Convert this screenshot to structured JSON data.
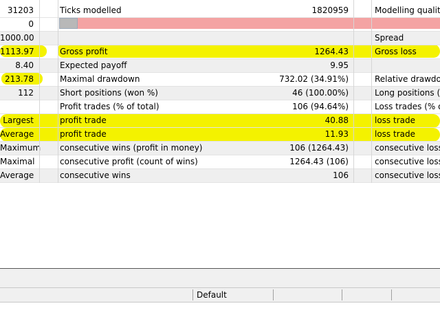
{
  "rows": [
    {
      "v1": "31203",
      "l2": "Ticks modelled",
      "v3": "1820959",
      "l4": "Modelling quality"
    },
    {
      "v1": "0",
      "l2": "",
      "v3": "",
      "l4": ""
    },
    {
      "v1": "1000.00",
      "l2": "",
      "v3": "",
      "l4": "Spread"
    },
    {
      "v1": "1113.97",
      "l2": "Gross profit",
      "v3": "1264.43",
      "l4": "Gross loss"
    },
    {
      "v1": "8.40",
      "l2": "Expected payoff",
      "v3": "9.95",
      "l4": ""
    },
    {
      "v1": "213.78",
      "l2": "Maximal drawdown",
      "v3": "732.02 (34.91%)",
      "l4": "Relative drawdown"
    },
    {
      "v1": "112",
      "l2": "Short positions (won %)",
      "v3": "46 (100.00%)",
      "l4": "Long positions (wo"
    },
    {
      "v1": "",
      "l2": "Profit trades (% of total)",
      "v3": "106 (94.64%)",
      "l4": "Loss trades (% of t"
    },
    {
      "v1": "Largest",
      "l2": "profit trade",
      "v3": "40.88",
      "l4": "loss trade"
    },
    {
      "v1": "Average",
      "l2": "profit trade",
      "v3": "11.93",
      "l4": "loss trade"
    },
    {
      "v1": "Maximum",
      "l2": "consecutive wins (profit in money)",
      "v3": "106 (1264.43)",
      "l4": "consecutive losses"
    },
    {
      "v1": "Maximal",
      "l2": "consecutive profit (count of wins)",
      "v3": "1264.43 (106)",
      "l4": "consecutive loss (c"
    },
    {
      "v1": "Average",
      "l2": "consecutive wins",
      "v3": "106",
      "l4": "consecutive losses"
    }
  ],
  "modelling_quality_bar": {
    "gray_color": "#b8b8b8",
    "pink_color": "#f4a3a3"
  },
  "highlight_color": "#f4f200",
  "status_bar": {
    "profile": "Default"
  }
}
